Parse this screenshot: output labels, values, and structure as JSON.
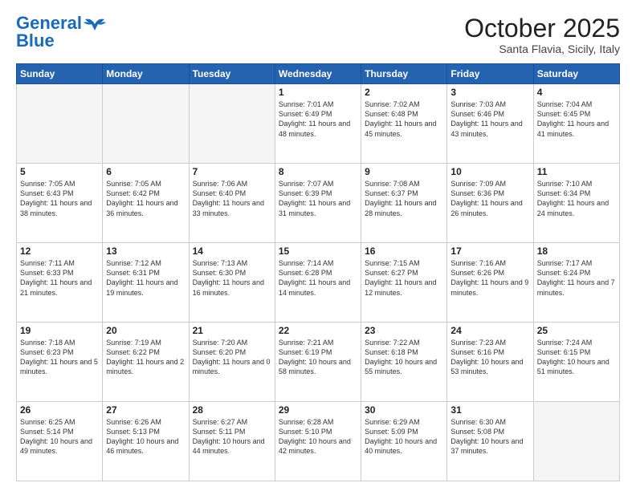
{
  "logo": {
    "line1": "General",
    "line2": "Blue"
  },
  "header": {
    "month": "October 2025",
    "location": "Santa Flavia, Sicily, Italy"
  },
  "weekdays": [
    "Sunday",
    "Monday",
    "Tuesday",
    "Wednesday",
    "Thursday",
    "Friday",
    "Saturday"
  ],
  "weeks": [
    [
      {
        "day": "",
        "info": ""
      },
      {
        "day": "",
        "info": ""
      },
      {
        "day": "",
        "info": ""
      },
      {
        "day": "1",
        "info": "Sunrise: 7:01 AM\nSunset: 6:49 PM\nDaylight: 11 hours\nand 48 minutes."
      },
      {
        "day": "2",
        "info": "Sunrise: 7:02 AM\nSunset: 6:48 PM\nDaylight: 11 hours\nand 45 minutes."
      },
      {
        "day": "3",
        "info": "Sunrise: 7:03 AM\nSunset: 6:46 PM\nDaylight: 11 hours\nand 43 minutes."
      },
      {
        "day": "4",
        "info": "Sunrise: 7:04 AM\nSunset: 6:45 PM\nDaylight: 11 hours\nand 41 minutes."
      }
    ],
    [
      {
        "day": "5",
        "info": "Sunrise: 7:05 AM\nSunset: 6:43 PM\nDaylight: 11 hours\nand 38 minutes."
      },
      {
        "day": "6",
        "info": "Sunrise: 7:05 AM\nSunset: 6:42 PM\nDaylight: 11 hours\nand 36 minutes."
      },
      {
        "day": "7",
        "info": "Sunrise: 7:06 AM\nSunset: 6:40 PM\nDaylight: 11 hours\nand 33 minutes."
      },
      {
        "day": "8",
        "info": "Sunrise: 7:07 AM\nSunset: 6:39 PM\nDaylight: 11 hours\nand 31 minutes."
      },
      {
        "day": "9",
        "info": "Sunrise: 7:08 AM\nSunset: 6:37 PM\nDaylight: 11 hours\nand 28 minutes."
      },
      {
        "day": "10",
        "info": "Sunrise: 7:09 AM\nSunset: 6:36 PM\nDaylight: 11 hours\nand 26 minutes."
      },
      {
        "day": "11",
        "info": "Sunrise: 7:10 AM\nSunset: 6:34 PM\nDaylight: 11 hours\nand 24 minutes."
      }
    ],
    [
      {
        "day": "12",
        "info": "Sunrise: 7:11 AM\nSunset: 6:33 PM\nDaylight: 11 hours\nand 21 minutes."
      },
      {
        "day": "13",
        "info": "Sunrise: 7:12 AM\nSunset: 6:31 PM\nDaylight: 11 hours\nand 19 minutes."
      },
      {
        "day": "14",
        "info": "Sunrise: 7:13 AM\nSunset: 6:30 PM\nDaylight: 11 hours\nand 16 minutes."
      },
      {
        "day": "15",
        "info": "Sunrise: 7:14 AM\nSunset: 6:28 PM\nDaylight: 11 hours\nand 14 minutes."
      },
      {
        "day": "16",
        "info": "Sunrise: 7:15 AM\nSunset: 6:27 PM\nDaylight: 11 hours\nand 12 minutes."
      },
      {
        "day": "17",
        "info": "Sunrise: 7:16 AM\nSunset: 6:26 PM\nDaylight: 11 hours\nand 9 minutes."
      },
      {
        "day": "18",
        "info": "Sunrise: 7:17 AM\nSunset: 6:24 PM\nDaylight: 11 hours\nand 7 minutes."
      }
    ],
    [
      {
        "day": "19",
        "info": "Sunrise: 7:18 AM\nSunset: 6:23 PM\nDaylight: 11 hours\nand 5 minutes."
      },
      {
        "day": "20",
        "info": "Sunrise: 7:19 AM\nSunset: 6:22 PM\nDaylight: 11 hours\nand 2 minutes."
      },
      {
        "day": "21",
        "info": "Sunrise: 7:20 AM\nSunset: 6:20 PM\nDaylight: 11 hours\nand 0 minutes."
      },
      {
        "day": "22",
        "info": "Sunrise: 7:21 AM\nSunset: 6:19 PM\nDaylight: 10 hours\nand 58 minutes."
      },
      {
        "day": "23",
        "info": "Sunrise: 7:22 AM\nSunset: 6:18 PM\nDaylight: 10 hours\nand 55 minutes."
      },
      {
        "day": "24",
        "info": "Sunrise: 7:23 AM\nSunset: 6:16 PM\nDaylight: 10 hours\nand 53 minutes."
      },
      {
        "day": "25",
        "info": "Sunrise: 7:24 AM\nSunset: 6:15 PM\nDaylight: 10 hours\nand 51 minutes."
      }
    ],
    [
      {
        "day": "26",
        "info": "Sunrise: 6:25 AM\nSunset: 5:14 PM\nDaylight: 10 hours\nand 49 minutes."
      },
      {
        "day": "27",
        "info": "Sunrise: 6:26 AM\nSunset: 5:13 PM\nDaylight: 10 hours\nand 46 minutes."
      },
      {
        "day": "28",
        "info": "Sunrise: 6:27 AM\nSunset: 5:11 PM\nDaylight: 10 hours\nand 44 minutes."
      },
      {
        "day": "29",
        "info": "Sunrise: 6:28 AM\nSunset: 5:10 PM\nDaylight: 10 hours\nand 42 minutes."
      },
      {
        "day": "30",
        "info": "Sunrise: 6:29 AM\nSunset: 5:09 PM\nDaylight: 10 hours\nand 40 minutes."
      },
      {
        "day": "31",
        "info": "Sunrise: 6:30 AM\nSunset: 5:08 PM\nDaylight: 10 hours\nand 37 minutes."
      },
      {
        "day": "",
        "info": ""
      }
    ]
  ]
}
